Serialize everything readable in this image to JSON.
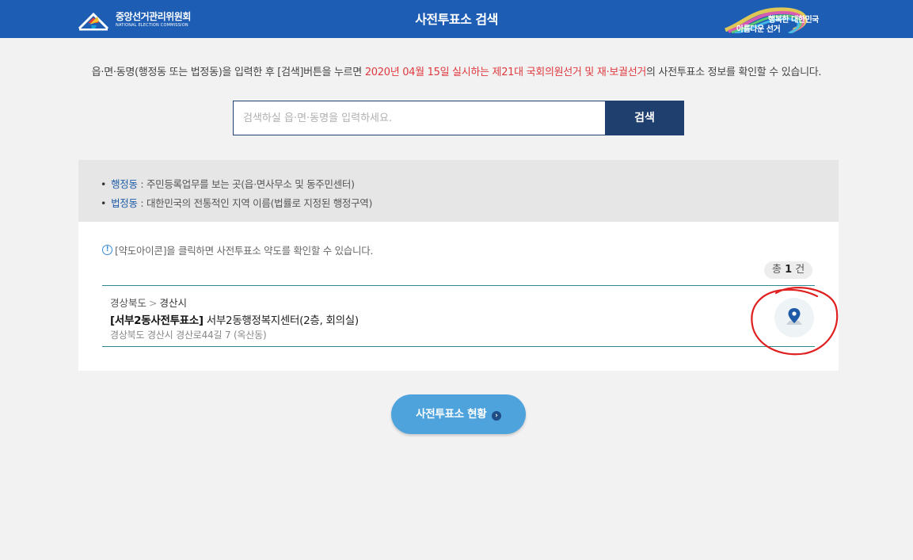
{
  "header": {
    "org_name_ko": "중앙선거관리위원회",
    "org_name_en": "NATIONAL ELECTION COMMISSION",
    "title": "사전투표소 검색",
    "slogan_line1": "행복한 대한민국",
    "slogan_line2": "아름다운 선거",
    "color": "#1d5db3"
  },
  "intro": {
    "text_before": "읍·면·동명(행정동 또는 법정동)을 입력한 후 [검색]버튼을 누르면 ",
    "highlight": "2020년 04월 15일 실시하는 제21대 국회의원선거 및 재·보궐선거",
    "text_after": "의 사전투표소 정보를 확인할 수 있습니다.",
    "highlight_color": "#e0393e"
  },
  "search": {
    "placeholder": "검색하실 읍·면·동명을 입력하세요.",
    "value": "",
    "button_label": "검색"
  },
  "info": {
    "items": [
      {
        "term": "행정동",
        "desc": " : 주민등록업무를 보는 곳(읍·면사무소 및 동주민센터)"
      },
      {
        "term": "법정동",
        "desc": " : 대한민국의 전통적인 지역 이름(법률로 지정된 행정구역)"
      }
    ]
  },
  "results": {
    "notice": "[약도아이콘]을 클릭하면 사전투표소 약도를 확인할 수 있습니다.",
    "count_prefix": "총 ",
    "count": "1",
    "count_suffix": " 건",
    "items": [
      {
        "province": "경상북도",
        "separator": ">",
        "city": "경산시",
        "name": "[서부2동사전투표소]",
        "location": " 서부2동행정복지센터(2층, 회의실)",
        "address": "경상북도 경산시 경산로44길 7 (옥산동)",
        "map_icon": "map-pin-icon"
      }
    ]
  },
  "footer": {
    "status_button_label": "사전투표소 현황",
    "status_button_color": "#4ea3dd"
  }
}
